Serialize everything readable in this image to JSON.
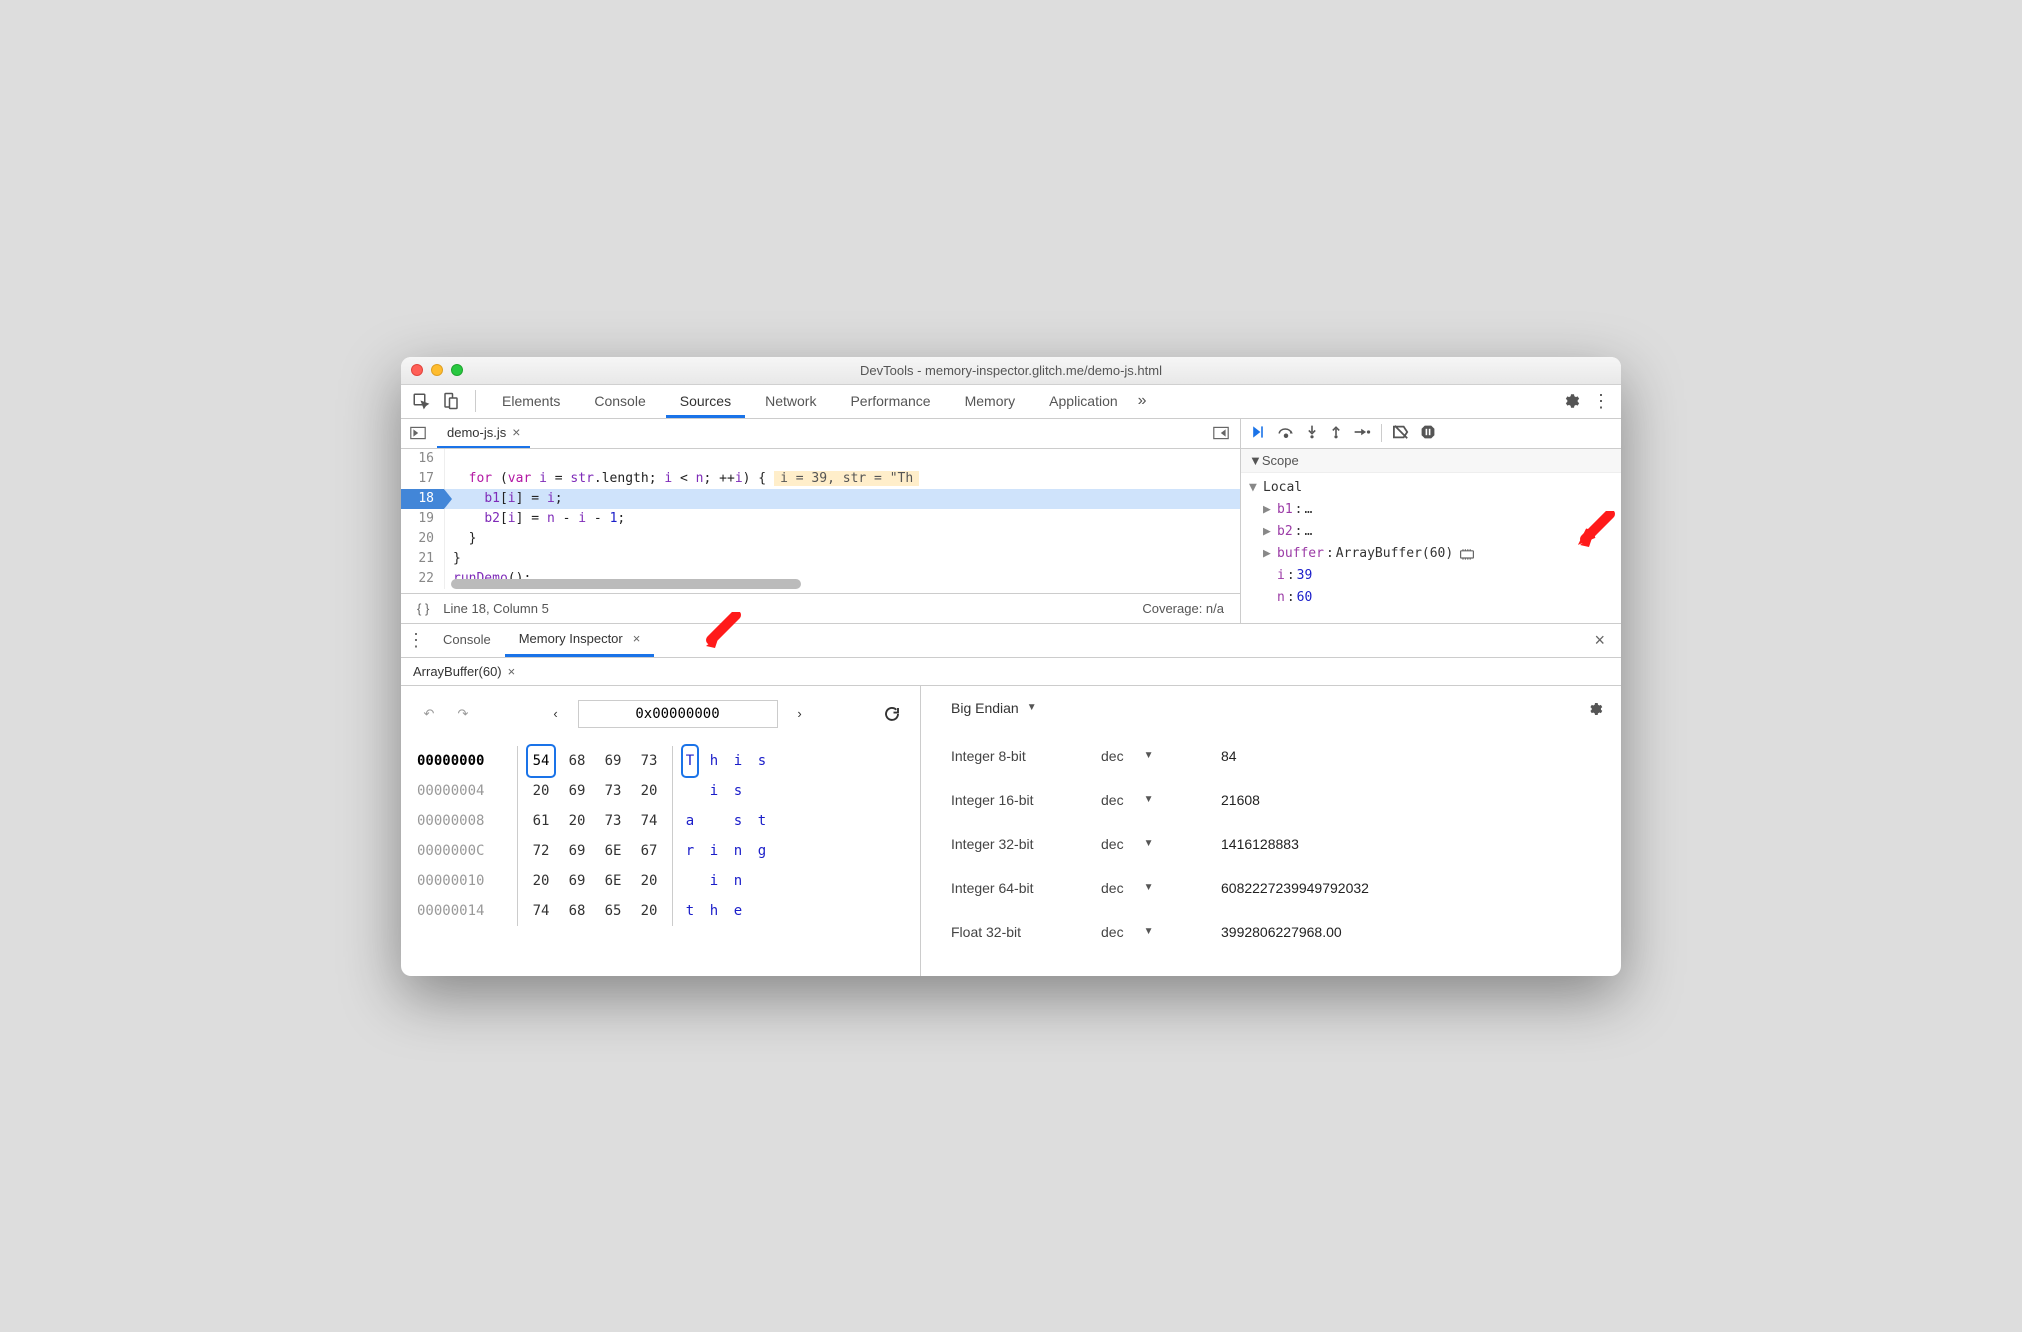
{
  "window": {
    "title": "DevTools - memory-inspector.glitch.me/demo-js.html"
  },
  "tabs": {
    "items": [
      "Elements",
      "Console",
      "Sources",
      "Network",
      "Performance",
      "Memory",
      "Application"
    ],
    "active_index": 2
  },
  "file_tab": {
    "name": "demo-js.js"
  },
  "code": {
    "lines": [
      {
        "n": 16,
        "text": ""
      },
      {
        "n": 17,
        "text": "  for (var i = str.length; i < n; ++i) {",
        "eval": "i = 39, str = \"Th"
      },
      {
        "n": 18,
        "text": "    b1[i] = i;",
        "current": true
      },
      {
        "n": 19,
        "text": "    b2[i] = n - i - 1;"
      },
      {
        "n": 20,
        "text": "  }"
      },
      {
        "n": 21,
        "text": "}"
      },
      {
        "n": 22,
        "text": "runDemo();"
      }
    ]
  },
  "status": {
    "pos": "Line 18, Column 5",
    "coverage": "Coverage: n/a"
  },
  "scope": {
    "header": "Scope",
    "local_label": "Local",
    "b1": {
      "k": "b1",
      "v": "…"
    },
    "b2": {
      "k": "b2",
      "v": "…"
    },
    "buffer": {
      "k": "buffer",
      "v": "ArrayBuffer(60)"
    },
    "i": {
      "k": "i",
      "v": "39"
    },
    "n": {
      "k": "n",
      "v": "60"
    }
  },
  "drawer": {
    "tabs": [
      "Console",
      "Memory Inspector"
    ],
    "active_index": 1
  },
  "mem": {
    "buffer_tab": "ArrayBuffer(60)",
    "addr": "0x00000000",
    "endian": "Big Endian",
    "rows": [
      {
        "addr": "00000000",
        "bytes": [
          "54",
          "68",
          "69",
          "73"
        ],
        "ascii": [
          "T",
          "h",
          "i",
          "s"
        ],
        "first": true
      },
      {
        "addr": "00000004",
        "bytes": [
          "20",
          "69",
          "73",
          "20"
        ],
        "ascii": [
          " ",
          "i",
          "s",
          " "
        ]
      },
      {
        "addr": "00000008",
        "bytes": [
          "61",
          "20",
          "73",
          "74"
        ],
        "ascii": [
          "a",
          " ",
          "s",
          "t"
        ]
      },
      {
        "addr": "0000000C",
        "bytes": [
          "72",
          "69",
          "6E",
          "67"
        ],
        "ascii": [
          "r",
          "i",
          "n",
          "g"
        ]
      },
      {
        "addr": "00000010",
        "bytes": [
          "20",
          "69",
          "6E",
          "20"
        ],
        "ascii": [
          " ",
          "i",
          "n",
          " "
        ]
      },
      {
        "addr": "00000014",
        "bytes": [
          "74",
          "68",
          "65",
          "20"
        ],
        "ascii": [
          "t",
          "h",
          "e",
          " "
        ]
      }
    ],
    "values": [
      {
        "type": "Integer 8-bit",
        "fmt": "dec",
        "value": "84"
      },
      {
        "type": "Integer 16-bit",
        "fmt": "dec",
        "value": "21608"
      },
      {
        "type": "Integer 32-bit",
        "fmt": "dec",
        "value": "1416128883"
      },
      {
        "type": "Integer 64-bit",
        "fmt": "dec",
        "value": "6082227239949792032"
      },
      {
        "type": "Float 32-bit",
        "fmt": "dec",
        "value": "3992806227968.00"
      }
    ]
  }
}
